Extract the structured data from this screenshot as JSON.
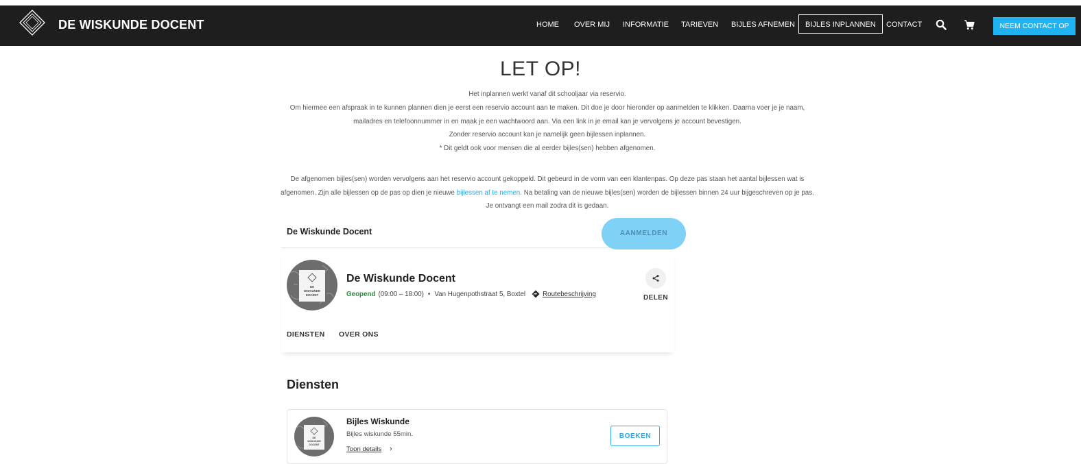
{
  "header": {
    "brand": "DE WISKUNDE DOCENT",
    "nav": [
      {
        "label": "HOME"
      },
      {
        "label": "OVER MIJ"
      },
      {
        "label": "INFORMATIE"
      },
      {
        "label": "TARIEVEN"
      },
      {
        "label": "BIJLES AFNEMEN"
      },
      {
        "label": "BIJLES INPLANNEN",
        "active": true
      },
      {
        "label": "CONTACT"
      }
    ],
    "search_icon": "search-icon",
    "cart_icon": "cart-icon",
    "cta_label": "NEEM CONTACT OP",
    "cta_color": "#20b3f1",
    "bg_color": "#1e1e1e"
  },
  "notice": {
    "title": "LET OP!",
    "line1": "Het inplannen werkt vanaf dit schooljaar via reservio.",
    "line2": "Om hiermee een afspraak in te kunnen plannen dien je eerst een reservio account aan te maken. Dit doe je door hieronder op aanmelden te klikken. Daarna voer je  je naam, mailadres en telefoonnummer in en maak je een wachtwoord aan. Via een link in je email kan je vervolgens je account bevestigen.",
    "line3": "Zonder reservio account kan je namelijk geen bijlessen inplannen.",
    "line4": "* Dit geldt ook voor mensen die al eerder bijles(sen) hebben afgenomen.",
    "para2_before": "De afgenomen bijles(sen) worden vervolgens aan het reservio account gekoppeld. Dit gebeurd in de vorm van een klantenpas. Op deze pas staan het aantal bijlessen wat is afgenomen. Zijn alle bijlessen op de pas op dien je nieuwe ",
    "para2_link": "bijlessen af te nemen.",
    "para2_after": "  Na betaling van de nieuwe bijles(sen) worden de bijlessen binnen 24 uur bijgeschreven op je pas. Je ontvangt een mail zodra dit is gedaan.",
    "link_color": "#1fa9ef"
  },
  "reservio": {
    "header_title": "De Wiskunde Docent",
    "register_label": "AANMELDEN",
    "register_color": "#7fd1f5",
    "business": {
      "name": "De Wiskunde Docent",
      "status": "Geopend",
      "hours": "(09:00 – 18:00)",
      "address": "Van Hugenpothstraat 5, Boxtel",
      "route_label": "Routebeschrijving",
      "route_icon": "directions-icon",
      "share_label": "DELEN",
      "share_icon": "share-icon",
      "avatar_text": [
        "DE",
        "WISKUNDE",
        "DOCENT"
      ],
      "status_color": "#2e8b3e"
    },
    "tabs": [
      {
        "label": "DIENSTEN"
      },
      {
        "label": "OVER ONS"
      }
    ],
    "services_title": "Diensten",
    "services": [
      {
        "title": "Bijles Wiskunde",
        "description": "Bijles wiskunde 55min.",
        "details_label": "Toon details",
        "book_label": "BOEKEN"
      }
    ]
  }
}
